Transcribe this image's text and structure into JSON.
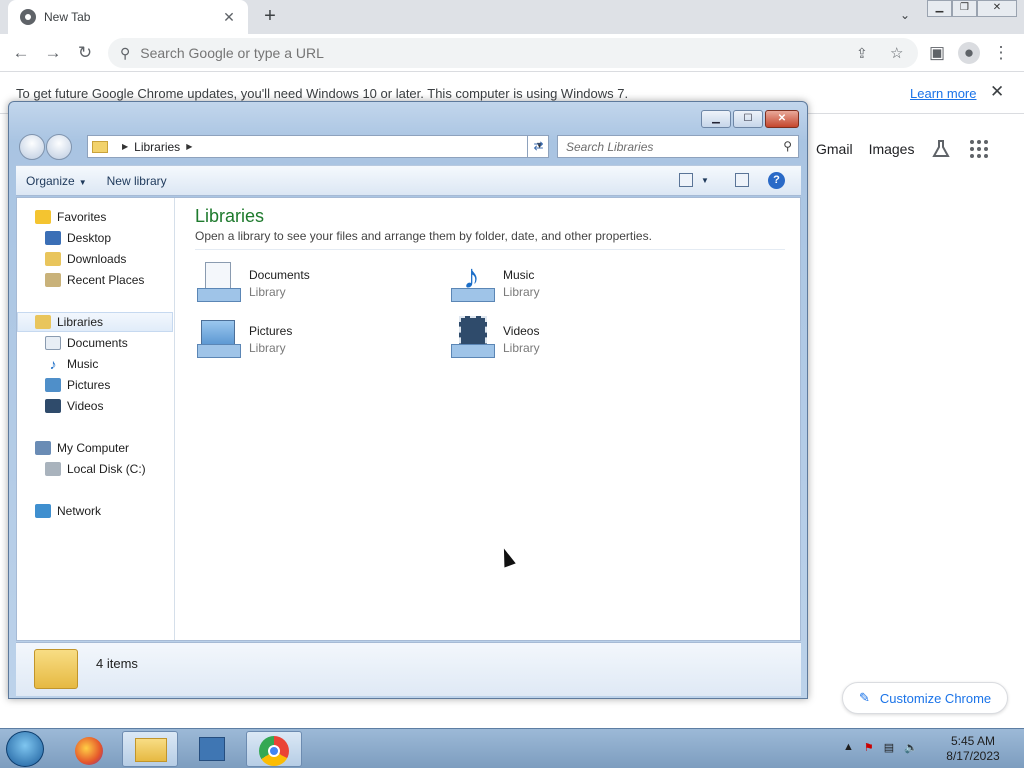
{
  "chrome": {
    "tab_title": "New Tab",
    "omnibox_placeholder": "Search Google or type a URL",
    "infobar_message": "To get future Google Chrome updates, you'll need Windows 10 or later. This computer is using Windows 7.",
    "infobar_link": "Learn more",
    "ntp_links": [
      "Gmail",
      "Images"
    ],
    "customize_label": "Customize Chrome"
  },
  "explorer": {
    "address_crumb": "Libraries",
    "search_placeholder": "Search Libraries",
    "commands": {
      "organize": "Organize",
      "new_library": "New library"
    },
    "nav": {
      "favorites": "Favorites",
      "favorites_items": [
        "Desktop",
        "Downloads",
        "Recent Places"
      ],
      "libraries": "Libraries",
      "libraries_items": [
        "Documents",
        "Music",
        "Pictures",
        "Videos"
      ],
      "computer": "My Computer",
      "computer_items": [
        "Local Disk (C:)"
      ],
      "network": "Network"
    },
    "content": {
      "title": "Libraries",
      "subtitle": "Open a library to see your files and arrange them by folder, date, and other properties.",
      "items": [
        {
          "name": "Documents",
          "type": "Library"
        },
        {
          "name": "Music",
          "type": "Library"
        },
        {
          "name": "Pictures",
          "type": "Library"
        },
        {
          "name": "Videos",
          "type": "Library"
        }
      ]
    },
    "status": "4 items"
  },
  "taskbar": {
    "time": "5:45 AM",
    "date": "8/17/2023"
  }
}
